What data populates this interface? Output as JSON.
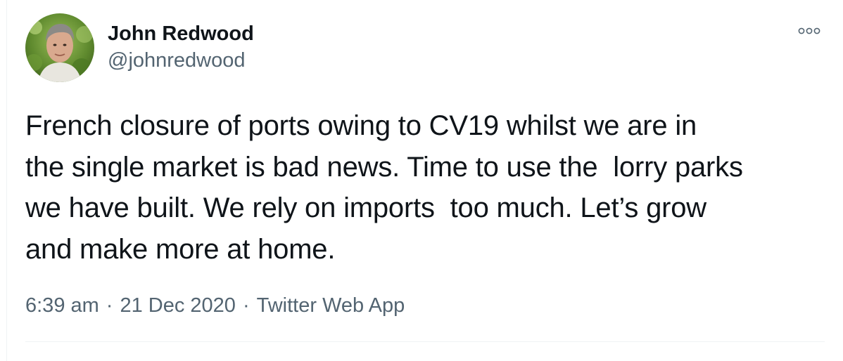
{
  "tweet": {
    "author": {
      "display_name": "John Redwood",
      "handle": "@johnredwood"
    },
    "text": "French closure of ports owing to CV19 whilst we are in\nthe single market is bad news. Time to use the  lorry parks\nwe have built. We rely on imports  too much. Let’s grow\nand make more at home.",
    "time": "6:39 am",
    "date": "21 Dec 2020",
    "source": "Twitter Web App",
    "separator": "·",
    "more_icon": "more-options-icon"
  },
  "colors": {
    "text_primary": "#0f1419",
    "text_secondary": "#536471",
    "divider": "#eff3f4"
  }
}
